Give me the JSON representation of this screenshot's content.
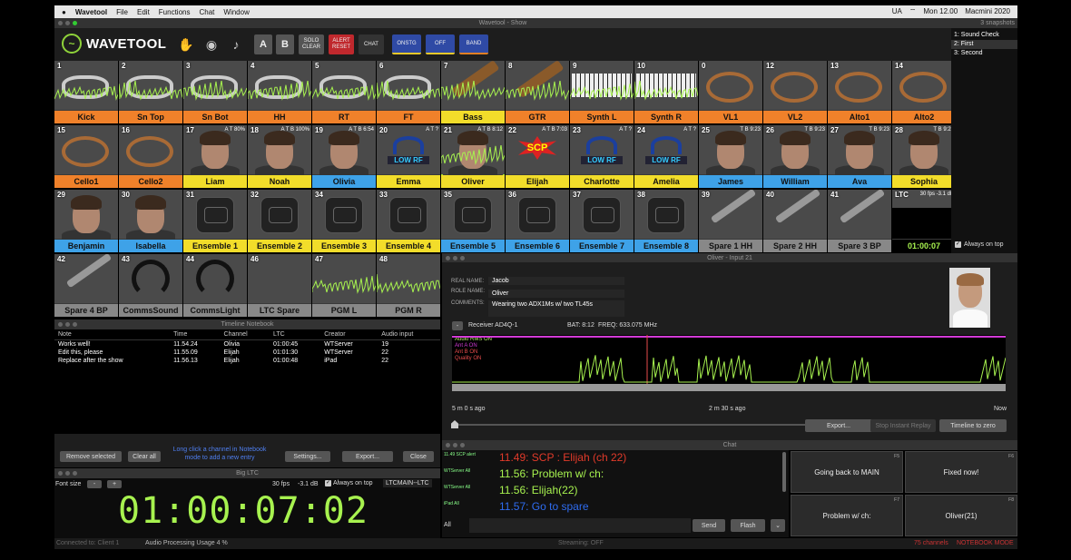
{
  "menubar": {
    "apple": "",
    "app": "Wavetool",
    "items": [
      "File",
      "Edit",
      "Functions",
      "Chat",
      "Window"
    ],
    "status": [
      "UA",
      "Mon 12.00",
      "Macmini 2020"
    ]
  },
  "window": {
    "title": "Wavetool - Show"
  },
  "toolbar": {
    "logo": "WAVETOOL",
    "a": "A",
    "b": "B",
    "solo": "SOLO CLEAR",
    "alert": "ALERT RESET",
    "chat": "CHAT",
    "tabs": [
      "ONSTG",
      "OFF",
      "BAND"
    ]
  },
  "colors": {
    "orange": "#f0812a",
    "yellow": "#f2dd2a",
    "blue": "#3ea2e8",
    "green": "#a7f24f"
  },
  "channels": [
    {
      "n": "1",
      "label": "Kick",
      "color": "orange",
      "kind": "drum"
    },
    {
      "n": "2",
      "label": "Sn Top",
      "color": "orange",
      "kind": "drum"
    },
    {
      "n": "3",
      "label": "Sn Bot",
      "color": "orange",
      "kind": "drum"
    },
    {
      "n": "4",
      "label": "HH",
      "color": "orange",
      "kind": "drum"
    },
    {
      "n": "5",
      "label": "RT",
      "color": "orange",
      "kind": "drum"
    },
    {
      "n": "6",
      "label": "FT",
      "color": "orange",
      "kind": "drum"
    },
    {
      "n": "7",
      "label": "Bass",
      "color": "yellow",
      "kind": "guitar"
    },
    {
      "n": "8",
      "label": "GTR",
      "color": "orange",
      "kind": "guitar"
    },
    {
      "n": "9",
      "label": "Synth L",
      "color": "orange",
      "kind": "keys"
    },
    {
      "n": "10",
      "label": "Synth R",
      "color": "orange",
      "kind": "keys"
    },
    {
      "n": "0",
      "label": "VL1",
      "color": "orange",
      "kind": "cable"
    },
    {
      "n": "12",
      "label": "VL2",
      "color": "orange",
      "kind": "cable"
    },
    {
      "n": "13",
      "label": "Alto1",
      "color": "orange",
      "kind": "cable"
    },
    {
      "n": "14",
      "label": "Alto2",
      "color": "orange",
      "kind": "cable"
    },
    {
      "n": "15",
      "label": "Cello1",
      "color": "orange",
      "kind": "cable"
    },
    {
      "n": "16",
      "label": "Cello2",
      "color": "orange",
      "kind": "cable"
    },
    {
      "n": "17",
      "label": "Liam",
      "color": "yellow",
      "kind": "face",
      "bat": "A T 80%"
    },
    {
      "n": "18",
      "label": "Noah",
      "color": "yellow",
      "kind": "face",
      "bat": "A T B 100%"
    },
    {
      "n": "19",
      "label": "Olivia",
      "color": "blue",
      "kind": "face",
      "bat": "A T B 6:54"
    },
    {
      "n": "20",
      "label": "Emma",
      "color": "yellow",
      "kind": "rf",
      "bat": "A T ?"
    },
    {
      "n": "21",
      "label": "Oliver",
      "color": "yellow",
      "kind": "face",
      "bat": "A T B 8:12",
      "selected": true
    },
    {
      "n": "22",
      "label": "Elijah",
      "color": "yellow",
      "kind": "scp",
      "bat": "A T B 7:03"
    },
    {
      "n": "23",
      "label": "Charlotte",
      "color": "yellow",
      "kind": "rf",
      "bat": "A T ?"
    },
    {
      "n": "24",
      "label": "Amelia",
      "color": "yellow",
      "kind": "rf",
      "bat": "A T ?"
    },
    {
      "n": "25",
      "label": "James",
      "color": "blue",
      "kind": "face",
      "bat": "T B 9:23"
    },
    {
      "n": "26",
      "label": "William",
      "color": "blue",
      "kind": "face",
      "bat": "T B 9:23"
    },
    {
      "n": "27",
      "label": "Ava",
      "color": "blue",
      "kind": "face",
      "bat": "T B 9:23"
    },
    {
      "n": "28",
      "label": "Sophia",
      "color": "yellow",
      "kind": "face",
      "bat": "T B 9:23"
    },
    {
      "n": "29",
      "label": "Benjamin",
      "color": "blue",
      "kind": "face"
    },
    {
      "n": "30",
      "label": "Isabella",
      "color": "blue",
      "kind": "face"
    },
    {
      "n": "31",
      "label": "Ensemble 1",
      "color": "yellow",
      "kind": "pack"
    },
    {
      "n": "32",
      "label": "Ensemble 2",
      "color": "yellow",
      "kind": "pack"
    },
    {
      "n": "34",
      "label": "Ensemble 3",
      "color": "yellow",
      "kind": "pack"
    },
    {
      "n": "33",
      "label": "Ensemble 4",
      "color": "yellow",
      "kind": "pack"
    },
    {
      "n": "35",
      "label": "Ensemble 5",
      "color": "blue",
      "kind": "pack"
    },
    {
      "n": "36",
      "label": "Ensemble 6",
      "color": "blue",
      "kind": "pack"
    },
    {
      "n": "37",
      "label": "Ensemble 7",
      "color": "blue",
      "kind": "pack"
    },
    {
      "n": "38",
      "label": "Ensemble 8",
      "color": "blue",
      "kind": "pack"
    },
    {
      "n": "39",
      "label": "Spare 1 HH",
      "color": "gray",
      "kind": "mic"
    },
    {
      "n": "40",
      "label": "Spare 2 HH",
      "color": "gray",
      "kind": "mic"
    },
    {
      "n": "41",
      "label": "Spare 3 BP",
      "color": "gray",
      "kind": "mic"
    },
    {
      "n": "LTC",
      "label": "01:00:07",
      "color": "black",
      "kind": "ltc",
      "bat": "30 fps -3.1 dB"
    },
    {
      "n": "42",
      "label": "Spare 4 BP",
      "color": "gray",
      "kind": "mic"
    },
    {
      "n": "43",
      "label": "CommsSound",
      "color": "gray",
      "kind": "hp"
    },
    {
      "n": "44",
      "label": "CommsLight",
      "color": "gray",
      "kind": "hp"
    },
    {
      "n": "46",
      "label": "LTC Spare",
      "color": "gray",
      "kind": "plain"
    },
    {
      "n": "47",
      "label": "PGM L",
      "color": "gray",
      "kind": "plain"
    },
    {
      "n": "48",
      "label": "PGM R",
      "color": "gray",
      "kind": "plain"
    }
  ],
  "snapshots": {
    "title": "3 snapshots",
    "items": [
      "1: Sound Check",
      "2: First",
      "3: Second"
    ],
    "always_on_top": "Always on top"
  },
  "notebook": {
    "title": "Timeline Notebook",
    "columns": [
      "Note",
      "Time",
      "Channel",
      "LTC",
      "Creator",
      "Audio input"
    ],
    "rows": [
      [
        "Works well!",
        "11.54.24",
        "Olivia",
        "01:00:45",
        "WTServer",
        "19"
      ],
      [
        "Edit this, please",
        "11.55.09",
        "Elijah",
        "01:01:30",
        "WTServer",
        "22"
      ],
      [
        "Replace after the show",
        "11.56.13",
        "Elijah",
        "01:00:48",
        "iPad",
        "22"
      ]
    ],
    "remove": "Remove selected",
    "clear": "Clear all",
    "hint": "Long click a channel in Notebook mode to add a new entry",
    "settings": "Settings...",
    "export": "Export...",
    "close": "Close"
  },
  "bigltc": {
    "title": "Big LTC",
    "font_size": "Font size",
    "minus": "-",
    "plus": "+",
    "fps": "30 fps",
    "db": "-3.1 dB",
    "ontop": "Always on top",
    "source": "LTCMAIN--LTC",
    "time": "01:00:07:02"
  },
  "info": {
    "title": "Oliver - Input 21",
    "real_name_k": "REAL NAME:",
    "real_name": "Jacob",
    "role_k": "ROLE NAME:",
    "role": "Oliver",
    "comments_k": "COMMENTS:",
    "comments": "Wearing two ADX1Ms w/ two TL45s",
    "receiver": "Receiver AD4Q-1",
    "bat": "BAT: 8:12",
    "freq": "FREQ: 633.075 MHz",
    "legend": [
      "Audio RMS ON",
      "Ant A ON",
      "Ant B ON",
      "Quality ON"
    ],
    "t_left": "5 m 0 s ago",
    "t_mid": "2 m 30 s ago",
    "t_right": "Now",
    "export": "Export...",
    "stop": "Stop Instant Replay",
    "zero": "Timeline to zero"
  },
  "chat": {
    "title": "Chat",
    "messages": [
      {
        "who": "11.49 SCP alert",
        "text": "11.49: SCP : Elijah (ch 22)",
        "color": "#e23a2a"
      },
      {
        "who": "WTServer All",
        "text": "11.56: Problem w/ ch:",
        "color": "#a7f24f"
      },
      {
        "who": "WTServer All",
        "text": "11.56: Elijah(22)",
        "color": "#a7f24f"
      },
      {
        "who": "iPad All",
        "text": "11.57: Go to spare",
        "color": "#2e6cf0"
      }
    ],
    "to": "All",
    "send": "Send",
    "flash": "Flash"
  },
  "quick": [
    {
      "k": "F5",
      "t": "Going back to MAIN"
    },
    {
      "k": "F6",
      "t": "Fixed now!"
    },
    {
      "k": "F7",
      "t": "Problem w/ ch:"
    },
    {
      "k": "F8",
      "t": "Oliver(21)"
    }
  ],
  "status": {
    "conn": "Connected to: Client 1",
    "cpu": "Audio Processing Usage 4 %",
    "stream": "Streaming: OFF",
    "chans": "75 channels",
    "mode": "NOTEBOOK MODE"
  }
}
